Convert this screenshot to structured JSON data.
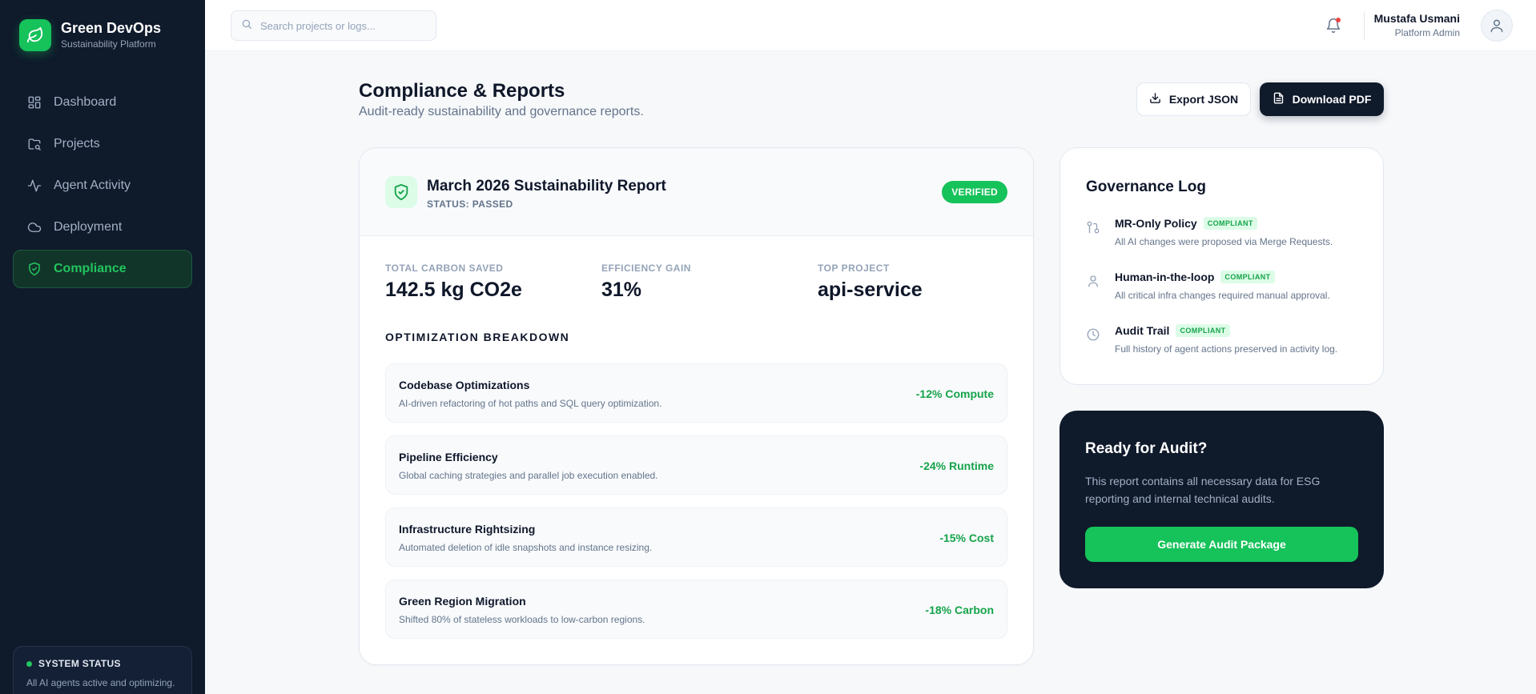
{
  "brand": {
    "name": "Green DevOps",
    "subtitle": "Sustainability Platform",
    "accent": "#16c25a"
  },
  "sidebar": {
    "items": [
      {
        "label": "Dashboard",
        "icon": "grid-icon",
        "active": false
      },
      {
        "label": "Projects",
        "icon": "folder-icon",
        "active": false
      },
      {
        "label": "Agent Activity",
        "icon": "activity-icon",
        "active": false
      },
      {
        "label": "Deployment",
        "icon": "cloud-icon",
        "active": false
      },
      {
        "label": "Compliance",
        "icon": "shield-check-icon",
        "active": true
      }
    ],
    "status": {
      "title": "SYSTEM STATUS",
      "text": "All AI agents active and optimizing."
    }
  },
  "topbar": {
    "search_placeholder": "Search projects or logs...",
    "user": {
      "name": "Mustafa Usmani",
      "role": "Platform Admin"
    }
  },
  "header": {
    "title": "Compliance & Reports",
    "subtitle": "Audit-ready sustainability and governance reports.",
    "export_label": "Export JSON",
    "download_label": "Download PDF"
  },
  "report": {
    "title": "March 2026 Sustainability Report",
    "status": "STATUS: PASSED",
    "badge": "VERIFIED",
    "metrics": [
      {
        "label": "TOTAL CARBON SAVED",
        "value": "142.5 kg CO2e"
      },
      {
        "label": "EFFICIENCY GAIN",
        "value": "31%"
      },
      {
        "label": "TOP PROJECT",
        "value": "api-service"
      }
    ],
    "breakdown_title": "OPTIMIZATION BREAKDOWN",
    "breakdown": [
      {
        "title": "Codebase Optimizations",
        "desc": "AI-driven refactoring of hot paths and SQL query optimization.",
        "value": "-12% Compute"
      },
      {
        "title": "Pipeline Efficiency",
        "desc": "Global caching strategies and parallel job execution enabled.",
        "value": "-24% Runtime"
      },
      {
        "title": "Infrastructure Rightsizing",
        "desc": "Automated deletion of idle snapshots and instance resizing.",
        "value": "-15% Cost"
      },
      {
        "title": "Green Region Migration",
        "desc": "Shifted 80% of stateless workloads to low-carbon regions.",
        "value": "-18% Carbon"
      }
    ]
  },
  "governance": {
    "title": "Governance Log",
    "items": [
      {
        "name": "MR-Only Policy",
        "badge": "COMPLIANT",
        "desc": "All AI changes were proposed via Merge Requests.",
        "icon": "git-merge-icon"
      },
      {
        "name": "Human-in-the-loop",
        "badge": "COMPLIANT",
        "desc": "All critical infra changes required manual approval.",
        "icon": "user-icon"
      },
      {
        "name": "Audit Trail",
        "badge": "COMPLIANT",
        "desc": "Full history of agent actions preserved in activity log.",
        "icon": "clock-icon"
      }
    ]
  },
  "audit": {
    "title": "Ready for Audit?",
    "desc": "This report contains all necessary data for ESG reporting and internal technical audits.",
    "button": "Generate Audit Package"
  }
}
